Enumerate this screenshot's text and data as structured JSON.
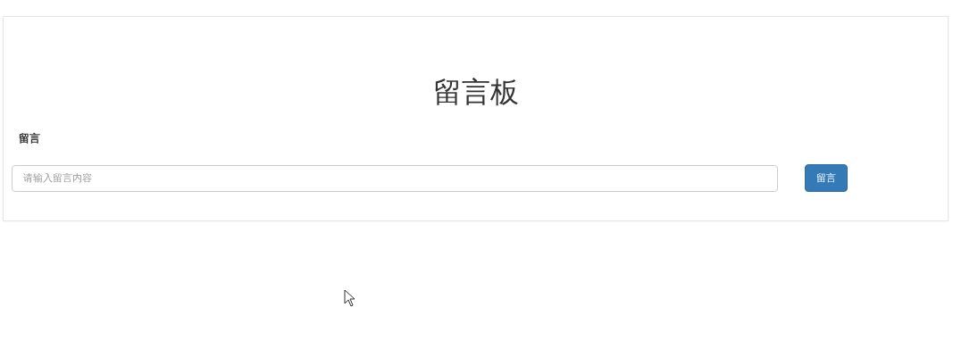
{
  "board": {
    "title": "留言板",
    "label": "留言",
    "input": {
      "placeholder": "请输入留言内容"
    },
    "submit_button": "留言"
  }
}
